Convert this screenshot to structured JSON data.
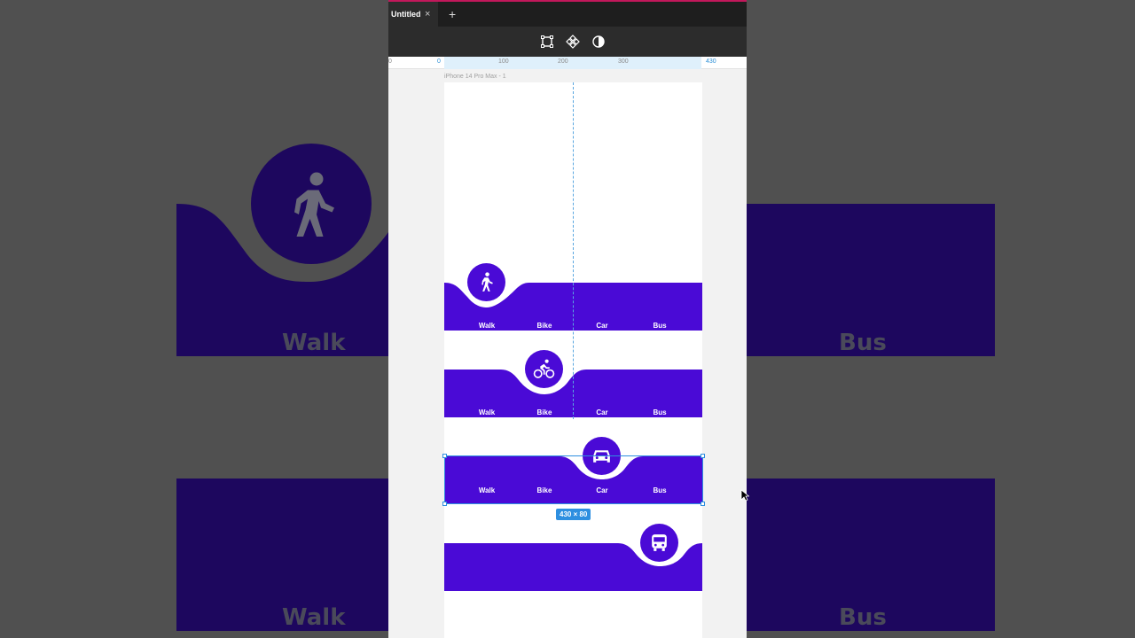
{
  "window": {
    "tab_title": "Untitled",
    "tab_close": "×",
    "tab_add": "+"
  },
  "toolbar": {
    "icons": [
      "frame-tool-icon",
      "component-icon",
      "contrast-icon"
    ]
  },
  "ruler": {
    "ticks": [
      "0",
      "0",
      "100",
      "200",
      "300",
      "430"
    ]
  },
  "frame": {
    "label": "iPhone 14 Pro Max - 1"
  },
  "navbars": [
    {
      "active": "Walk",
      "labels": [
        "Walk",
        "Bike",
        "Car",
        "Bus"
      ]
    },
    {
      "active": "Bike",
      "labels": [
        "Walk",
        "Bike",
        "Car",
        "Bus"
      ]
    },
    {
      "active": "Car",
      "labels": [
        "Walk",
        "Bike",
        "Car",
        "Bus"
      ]
    },
    {
      "active": "Bus",
      "labels": []
    }
  ],
  "selection": {
    "dimensions": "430 × 80"
  },
  "background": {
    "left_label": "Walk",
    "right_label": "Bus"
  },
  "colors": {
    "nav_purple": "#4a0ad6",
    "bg_purple": "#1d075e",
    "selection_blue": "#2e8fe0"
  }
}
